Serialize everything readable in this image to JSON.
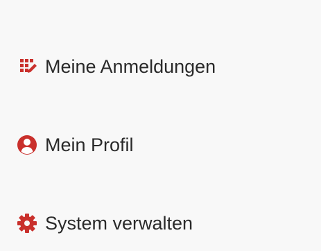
{
  "accent_color": "#c9302c",
  "menu": {
    "items": [
      {
        "label": "Meine Anmeldungen",
        "icon": "calendar-edit-icon"
      },
      {
        "label": "Mein Profil",
        "icon": "user-circle-icon"
      },
      {
        "label": "System verwalten",
        "icon": "gear-icon"
      }
    ]
  }
}
